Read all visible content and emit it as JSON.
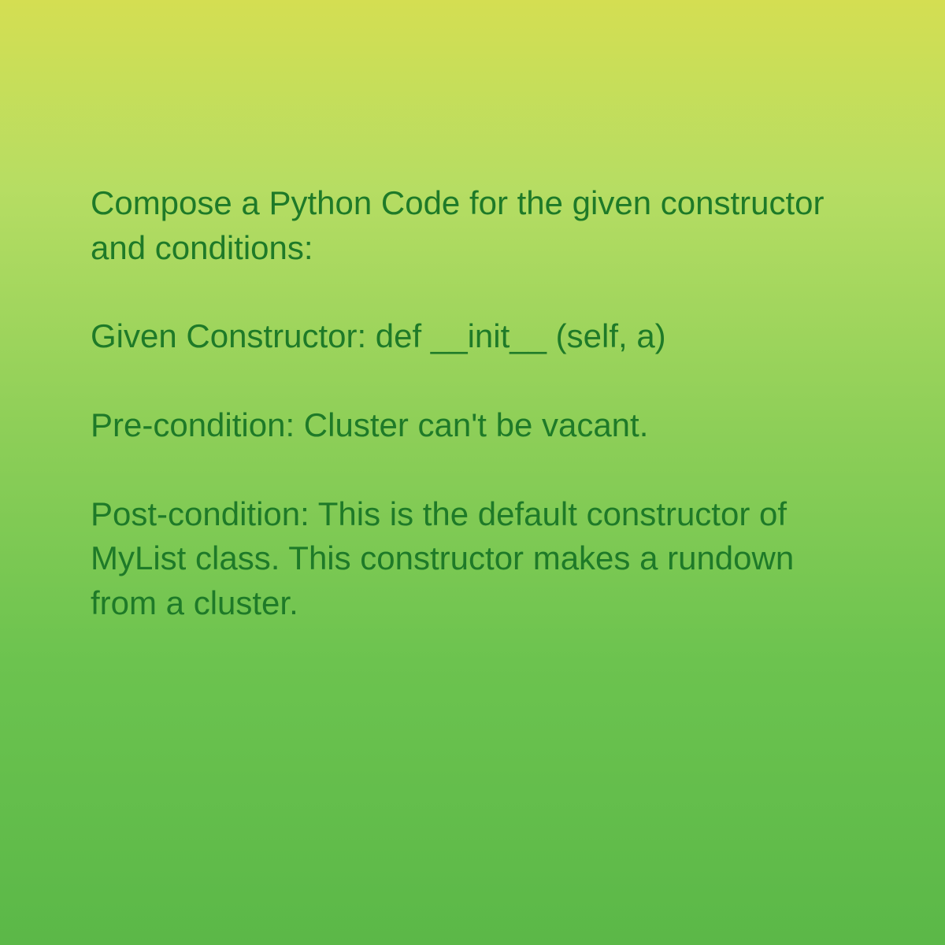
{
  "content": {
    "intro": "Compose a Python Code for the given constructor and conditions:",
    "constructor": "Given Constructor: def __init__ (self, a)",
    "precondition": "Pre-condition: Cluster can't be vacant.",
    "postcondition": "Post-condition: This is the default constructor of MyList class. This constructor makes a rundown from a cluster."
  }
}
